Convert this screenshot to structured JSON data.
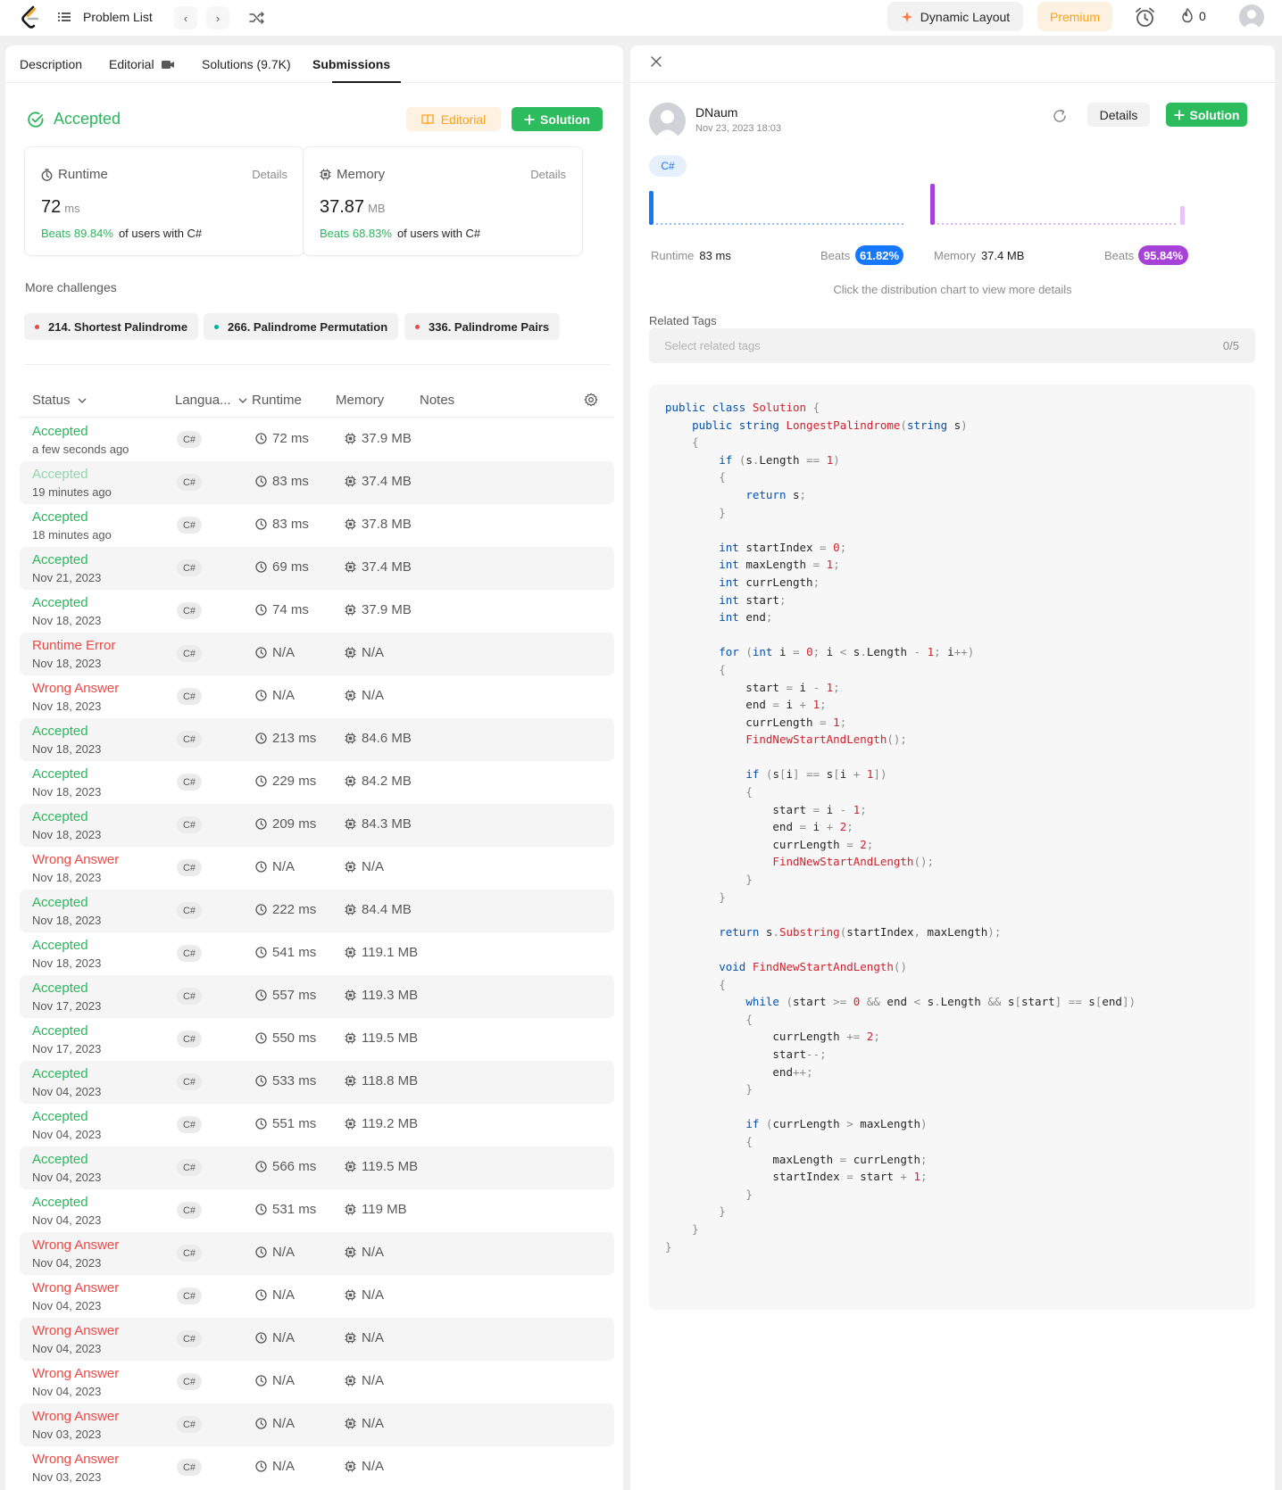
{
  "topbar": {
    "problem_list_label": "Problem List",
    "dynamic_layout_label": "Dynamic Layout",
    "premium_label": "Premium",
    "streak_count": "0",
    "colors": {
      "brand": "#ffa116",
      "accent_green": "#2cbb5d"
    }
  },
  "tabs": [
    {
      "label": "Description"
    },
    {
      "label": "Editorial"
    },
    {
      "label": "Solutions (9.7K)"
    },
    {
      "label": "Submissions"
    }
  ],
  "result": {
    "status": "Accepted",
    "editorial_label": "Editorial",
    "solution_label": "Solution",
    "runtime": {
      "label": "Runtime",
      "details": "Details",
      "value": "72",
      "unit": "ms",
      "beats": "Beats 89.84%",
      "suffix": "of users with C#"
    },
    "memory": {
      "label": "Memory",
      "details": "Details",
      "value": "37.87",
      "unit": "MB",
      "beats": "Beats 68.83%",
      "suffix": "of users with C#"
    }
  },
  "more_challenges": {
    "title": "More challenges",
    "items": [
      {
        "label": "214. Shortest Palindrome",
        "dot": "#ef4743"
      },
      {
        "label": "266. Palindrome Permutation",
        "dot": "#00af9b"
      },
      {
        "label": "336. Palindrome Pairs",
        "dot": "#ef4743"
      }
    ]
  },
  "table": {
    "headers": {
      "status": "Status",
      "language": "Langua...",
      "runtime": "Runtime",
      "memory": "Memory",
      "notes": "Notes"
    },
    "rows": [
      {
        "status": "Accepted",
        "kind": "ok",
        "date": "a few seconds ago",
        "lang": "C#",
        "runtime": "72 ms",
        "memory": "37.9 MB"
      },
      {
        "status": "Accepted",
        "kind": "okfade",
        "date": "19 minutes ago",
        "lang": "C#",
        "runtime": "83 ms",
        "memory": "37.4 MB"
      },
      {
        "status": "Accepted",
        "kind": "ok",
        "date": "18 minutes ago",
        "lang": "C#",
        "runtime": "83 ms",
        "memory": "37.8 MB"
      },
      {
        "status": "Accepted",
        "kind": "ok",
        "date": "Nov 21, 2023",
        "lang": "C#",
        "runtime": "69 ms",
        "memory": "37.4 MB"
      },
      {
        "status": "Accepted",
        "kind": "ok",
        "date": "Nov 18, 2023",
        "lang": "C#",
        "runtime": "74 ms",
        "memory": "37.9 MB"
      },
      {
        "status": "Runtime Error",
        "kind": "err",
        "date": "Nov 18, 2023",
        "lang": "C#",
        "runtime": "N/A",
        "memory": "N/A"
      },
      {
        "status": "Wrong Answer",
        "kind": "err",
        "date": "Nov 18, 2023",
        "lang": "C#",
        "runtime": "N/A",
        "memory": "N/A"
      },
      {
        "status": "Accepted",
        "kind": "ok",
        "date": "Nov 18, 2023",
        "lang": "C#",
        "runtime": "213 ms",
        "memory": "84.6 MB"
      },
      {
        "status": "Accepted",
        "kind": "ok",
        "date": "Nov 18, 2023",
        "lang": "C#",
        "runtime": "229 ms",
        "memory": "84.2 MB"
      },
      {
        "status": "Accepted",
        "kind": "ok",
        "date": "Nov 18, 2023",
        "lang": "C#",
        "runtime": "209 ms",
        "memory": "84.3 MB"
      },
      {
        "status": "Wrong Answer",
        "kind": "err",
        "date": "Nov 18, 2023",
        "lang": "C#",
        "runtime": "N/A",
        "memory": "N/A"
      },
      {
        "status": "Accepted",
        "kind": "ok",
        "date": "Nov 18, 2023",
        "lang": "C#",
        "runtime": "222 ms",
        "memory": "84.4 MB"
      },
      {
        "status": "Accepted",
        "kind": "ok",
        "date": "Nov 18, 2023",
        "lang": "C#",
        "runtime": "541 ms",
        "memory": "119.1 MB"
      },
      {
        "status": "Accepted",
        "kind": "ok",
        "date": "Nov 17, 2023",
        "lang": "C#",
        "runtime": "557 ms",
        "memory": "119.3 MB"
      },
      {
        "status": "Accepted",
        "kind": "ok",
        "date": "Nov 17, 2023",
        "lang": "C#",
        "runtime": "550 ms",
        "memory": "119.5 MB"
      },
      {
        "status": "Accepted",
        "kind": "ok",
        "date": "Nov 04, 2023",
        "lang": "C#",
        "runtime": "533 ms",
        "memory": "118.8 MB"
      },
      {
        "status": "Accepted",
        "kind": "ok",
        "date": "Nov 04, 2023",
        "lang": "C#",
        "runtime": "551 ms",
        "memory": "119.2 MB"
      },
      {
        "status": "Accepted",
        "kind": "ok",
        "date": "Nov 04, 2023",
        "lang": "C#",
        "runtime": "566 ms",
        "memory": "119.5 MB"
      },
      {
        "status": "Accepted",
        "kind": "ok",
        "date": "Nov 04, 2023",
        "lang": "C#",
        "runtime": "531 ms",
        "memory": "119 MB"
      },
      {
        "status": "Wrong Answer",
        "kind": "err",
        "date": "Nov 04, 2023",
        "lang": "C#",
        "runtime": "N/A",
        "memory": "N/A"
      },
      {
        "status": "Wrong Answer",
        "kind": "err",
        "date": "Nov 04, 2023",
        "lang": "C#",
        "runtime": "N/A",
        "memory": "N/A"
      },
      {
        "status": "Wrong Answer",
        "kind": "err",
        "date": "Nov 04, 2023",
        "lang": "C#",
        "runtime": "N/A",
        "memory": "N/A"
      },
      {
        "status": "Wrong Answer",
        "kind": "err",
        "date": "Nov 04, 2023",
        "lang": "C#",
        "runtime": "N/A",
        "memory": "N/A"
      },
      {
        "status": "Wrong Answer",
        "kind": "err",
        "date": "Nov 03, 2023",
        "lang": "C#",
        "runtime": "N/A",
        "memory": "N/A"
      },
      {
        "status": "Wrong Answer",
        "kind": "err",
        "date": "Nov 03, 2023",
        "lang": "C#",
        "runtime": "N/A",
        "memory": "N/A"
      }
    ]
  },
  "detail": {
    "user": "DNaum",
    "date": "Nov 23, 2023 18:03",
    "details_label": "Details",
    "solution_label": "Solution",
    "language": "C#",
    "runtime": {
      "label": "Runtime",
      "value": "83 ms",
      "beats_label": "Beats",
      "beats": "61.82%",
      "color": "#1677ff"
    },
    "memory": {
      "label": "Memory",
      "value": "37.4 MB",
      "beats_label": "Beats",
      "beats": "95.84%",
      "color": "#a642d8"
    },
    "hint": "Click the distribution chart to view more details",
    "related_tags_label": "Related Tags",
    "tags_placeholder": "Select related tags",
    "tags_count": "0/5",
    "code": [
      "public class Solution {",
      "    public string LongestPalindrome(string s)",
      "    {",
      "        if (s.Length == 1)",
      "        {",
      "            return s;",
      "        }",
      "",
      "        int startIndex = 0;",
      "        int maxLength = 1;",
      "        int currLength;",
      "        int start;",
      "        int end;",
      "",
      "        for (int i = 0; i < s.Length - 1; i++)",
      "        {",
      "            start = i - 1;",
      "            end = i + 1;",
      "            currLength = 1;",
      "            FindNewStartAndLength();",
      "",
      "            if (s[i] == s[i + 1])",
      "            {",
      "                start = i - 1;",
      "                end = i + 2;",
      "                currLength = 2;",
      "                FindNewStartAndLength();",
      "            }",
      "        }",
      "",
      "        return s.Substring(startIndex, maxLength);",
      "",
      "        void FindNewStartAndLength()",
      "        {",
      "            while (start >= 0 && end < s.Length && s[start] == s[end])",
      "            {",
      "                currLength += 2;",
      "                start--;",
      "                end++;",
      "            }",
      "",
      "            if (currLength > maxLength)",
      "            {",
      "                maxLength = currLength;",
      "                startIndex = start + 1;",
      "            }",
      "        }",
      "    }",
      "}"
    ]
  }
}
